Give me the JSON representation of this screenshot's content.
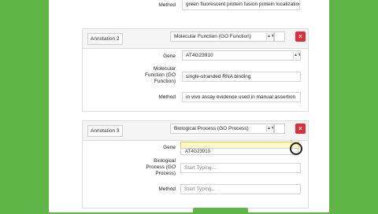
{
  "top_row": {
    "label": "Method",
    "value": "green fluorescent protein fusion protein localization evid"
  },
  "annotation2": {
    "label": "Annotation 2",
    "type": "Molecular Function (GO Function)",
    "delete": "×",
    "gene_label": "Gene",
    "gene_value": "AT4G23910",
    "mf_label_1": "Molecular",
    "mf_label_2": "Function (GO",
    "mf_label_3": "Function)",
    "mf_value": "single-stranded RNA binding",
    "method_label": "Method",
    "method_value": "in vivo assay evidence used in manual assertion"
  },
  "annotation3": {
    "label": "Annotation 3",
    "type": "Biological Process (GO Process)",
    "delete": "×",
    "gene_label": "Gene",
    "gene_suggestion": "AT4G23910",
    "bp_label_1": "Biological",
    "bp_label_2": "Process (GO",
    "bp_label_3": "Process)",
    "bp_placeholder": "Start Typing...",
    "method_label": "Method",
    "method_placeholder": "Start Typing..."
  }
}
